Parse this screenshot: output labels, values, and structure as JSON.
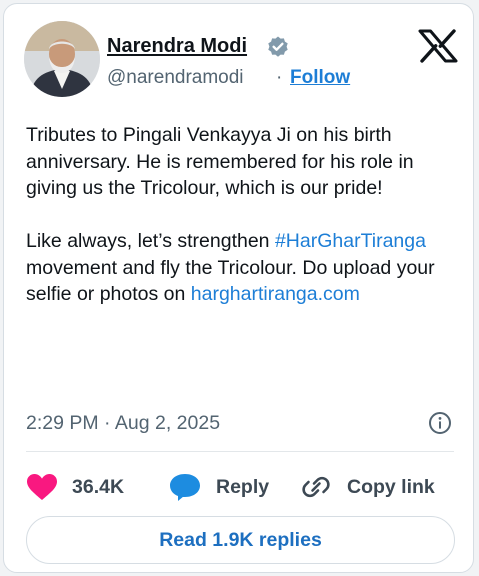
{
  "author": {
    "name": "Narendra Modi",
    "handle": "@narendramodi",
    "separator": "·",
    "follow_label": "Follow"
  },
  "tweet": {
    "paragraph1": "Tributes to Pingali Venkayya Ji on his birth anniversary. He is remembered for his role in giving us the Tricolour, which is our pride!",
    "p2_start": "Like always, let’s strengthen ",
    "hashtag": "#HarGharTiranga",
    "p2_middle": " movement and fly the Tricolour. Do upload your selfie or photos on ",
    "url": "harghartiranga.com",
    "timestamp": "2:29 PM · Aug 2, 2025"
  },
  "actions": {
    "likes": "36.4K",
    "reply_label": "Reply",
    "copy_label": "Copy link"
  },
  "read_replies_label": "Read 1.9K replies",
  "colors": {
    "accent": "#1d7ed6",
    "like": "#f91880",
    "verified": "#829aab"
  }
}
